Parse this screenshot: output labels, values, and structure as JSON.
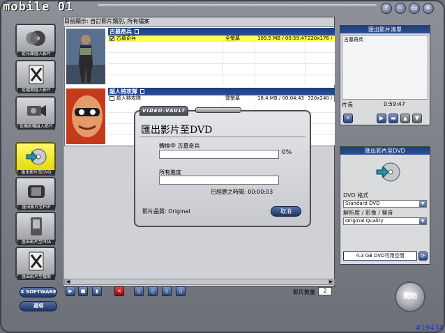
{
  "app": {
    "logo_text": "mobile 01",
    "status": "目前顯示: 自訂影片類別, 所有檔案",
    "window_buttons": [
      "?",
      "–",
      "▭",
      "✕"
    ]
  },
  "sidebar": {
    "items": [
      {
        "label": "從光碟匯入影片",
        "icon": "disc-import-icon"
      },
      {
        "label": "從檔案匯入影片",
        "icon": "file-import-icon"
      },
      {
        "label": "從攝影機匯入影片",
        "icon": "camera-import-icon"
      },
      {
        "label": "匯出影片至DVD",
        "icon": "dvd-export-icon"
      },
      {
        "label": "匯出影片至PSP",
        "icon": "psp-export-icon"
      },
      {
        "label": "匯出影片至PDA",
        "icon": "pda-export-icon"
      },
      {
        "label": "匯出影片至檔案",
        "icon": "file-export-icon"
      }
    ],
    "software_button": "X SOFTWARE",
    "help_button": "選項"
  },
  "movies": [
    {
      "title": "古墓奇兵",
      "file": "古墓奇兵",
      "aspect": "全螢幕",
      "size_length": "109.5 MB / 00:59:47",
      "resolution": "220x176 /",
      "checked": true
    },
    {
      "title": "超人特攻隊",
      "file": "超人特攻隊",
      "aspect": "寬螢幕",
      "size_length": "18.4 MB / 00:04:43",
      "resolution": "320x240 /",
      "checked": false
    }
  ],
  "export_list": {
    "header": "匯出影片清單",
    "items": [
      "古墓奇兵"
    ],
    "length_label": "片長",
    "length_value": "0:59:47"
  },
  "dvd_panel": {
    "header": "匯出影片至DVD",
    "format_label": "DVD 格式",
    "format_value": "Standard DVD",
    "quality_label": "解析度 / 影像 / 聲音",
    "quality_value": "Original Quality",
    "space_text": "4.3 GB DVD可用空間"
  },
  "dialog": {
    "brand": "VIDEO-VAULT",
    "title": "匯出影片至DVD",
    "converting_label": "轉換中 古墓奇兵",
    "converting_progress": 0,
    "converting_pct": "0%",
    "overall_label": "所有進度",
    "overall_progress": 0,
    "elapsed_text": "已經歷之時間: 00:00:03",
    "quality_text": "影片品質: Original",
    "cancel_button": "取消"
  },
  "bottom": {
    "count_label": "影片數量",
    "count_value": "2"
  },
  "start_button": "開始",
  "watermark": "#19434"
}
